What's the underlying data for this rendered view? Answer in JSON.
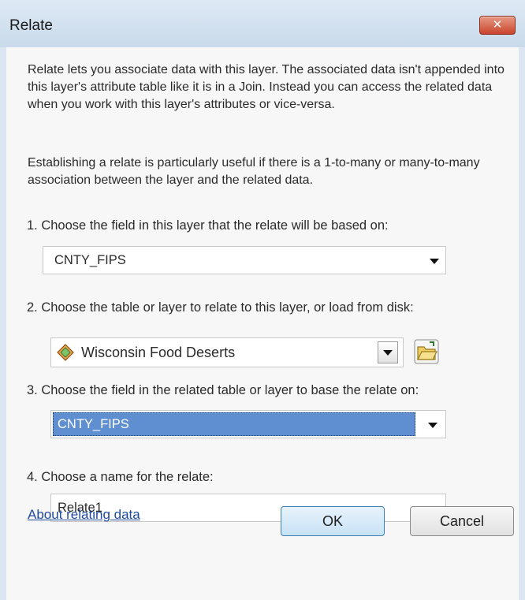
{
  "window": {
    "title": "Relate",
    "close_label": "✕"
  },
  "intro_text": "Relate lets you associate data with this layer. The associated data isn't appended into this layer's attribute table like it is in a Join. Instead you can access the related data when you work with this layer's attributes or vice-versa.",
  "relate_note": "Establishing a relate is particularly useful if there is a 1-to-many or many-to-many association between the layer and the related data.",
  "step1": {
    "label": "1. Choose the field in this layer that the relate will be based on:",
    "value": "CNTY_FIPS"
  },
  "step2": {
    "label": "2. Choose the table or layer to relate to this layer, or load from disk:",
    "value": "Wisconsin Food Deserts",
    "layer_icon": "layer-diamond-icon",
    "open_icon": "open-folder-icon"
  },
  "step3": {
    "label": "3. Choose the field in the related table or layer to base the relate on:",
    "value": "CNTY_FIPS"
  },
  "step4": {
    "label": "4. Choose a name for the relate:",
    "value": "Relate1"
  },
  "footer": {
    "help_link": "About relating data",
    "ok_label": "OK",
    "cancel_label": "Cancel"
  },
  "colors": {
    "selection": "#5f8fd1",
    "link": "#1f4aa0",
    "close": "#c9452c"
  }
}
